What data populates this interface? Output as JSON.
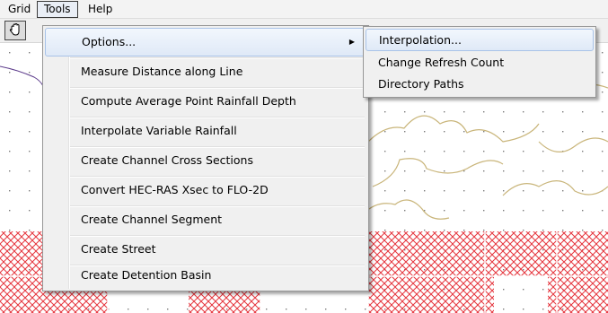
{
  "menubar": {
    "items": [
      {
        "label": "Grid"
      },
      {
        "label": "Tools",
        "active": true
      },
      {
        "label": "Help"
      }
    ]
  },
  "toolbar": {
    "hand_icon": "hand-pan-icon"
  },
  "tools_menu": {
    "items": [
      {
        "label": "Options...",
        "has_submenu": true,
        "highlighted": true
      },
      {
        "label": "Measure Distance along Line"
      },
      {
        "label": "Compute Average Point Rainfall Depth"
      },
      {
        "label": "Interpolate Variable Rainfall"
      },
      {
        "label": "Create Channel Cross Sections"
      },
      {
        "label": "Convert HEC-RAS Xsec to FLO-2D"
      },
      {
        "label": "Create Channel Segment"
      },
      {
        "label": "Create Street"
      },
      {
        "label": "Create Detention Basin"
      }
    ]
  },
  "options_submenu": {
    "items": [
      {
        "label": "Interpolation...",
        "highlighted": true
      },
      {
        "label": "Change Refresh Count"
      },
      {
        "label": "Directory Paths"
      }
    ]
  },
  "colors": {
    "contour": "#c9b57a",
    "hatch": "#e5343c",
    "grid_dot": "#7a7a7a",
    "menu_highlight_border": "#a8c3e8"
  }
}
